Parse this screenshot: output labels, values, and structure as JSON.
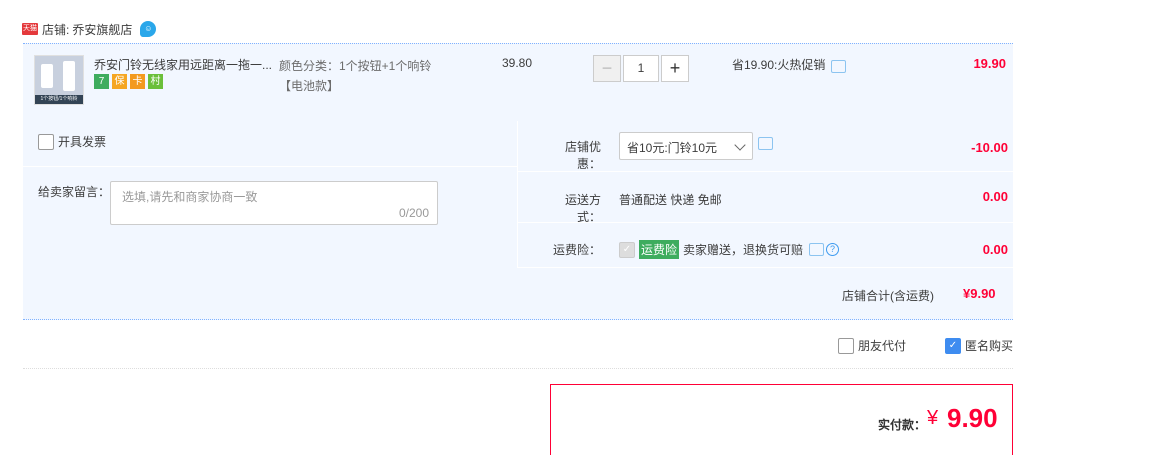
{
  "shop": {
    "badge": "天猫",
    "label": "店铺:",
    "name": "乔安旗舰店"
  },
  "item": {
    "title": "乔安门铃无线家用远距离一拖一...",
    "thumb_caption": "1个按钮/1个响铃",
    "sku_line1": "颜色分类：1个按钮+1个响铃",
    "sku_line2": "【电池款】",
    "price": "39.80",
    "qty": "1",
    "promo": "省19.90:火热促销",
    "subtotal": "19.90",
    "service_icons": [
      "7",
      "保",
      "卡",
      "村"
    ]
  },
  "invoice": {
    "label": "开具发票"
  },
  "message": {
    "label": "给卖家留言：",
    "placeholder": "选填,请先和商家协商一致",
    "count": "0/200"
  },
  "coupon": {
    "label": "店铺优惠：",
    "selected": "省10元:门铃10元",
    "value": "-10.00"
  },
  "shipping": {
    "label": "运送方式：",
    "method": "普通配送 快递 免邮",
    "value": "0.00"
  },
  "insurance": {
    "label": "运费险：",
    "badge": "运费险",
    "desc": "卖家赠送，退换货可赔",
    "value": "0.00"
  },
  "total": {
    "label": "店铺合计(含运费)",
    "value": "¥9.90"
  },
  "options": {
    "friend_pay": "朋友代付",
    "anonymous": "匿名购买"
  },
  "pay": {
    "label": "实付款：",
    "currency": "¥",
    "amount": "9.90"
  },
  "colors": {
    "accent": "#ff0036",
    "band": "#f2f7ff",
    "checkbox": "#3e8cf0",
    "insurance_badge": "#3eac5e"
  }
}
